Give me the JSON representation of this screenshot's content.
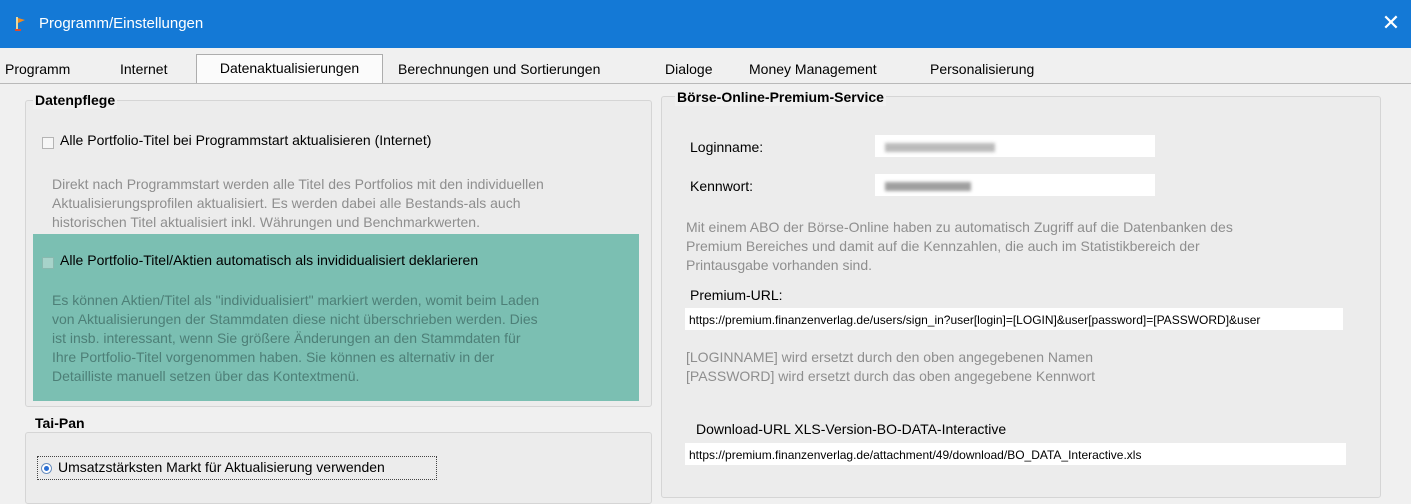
{
  "window": {
    "title": "Programm/Einstellungen",
    "close_glyph": "✕",
    "app_icon": "app-flag-icon"
  },
  "tabs": [
    {
      "label": "Programm"
    },
    {
      "label": "Internet"
    },
    {
      "label": "Datenaktualisierungen",
      "active": true
    },
    {
      "label": "Berechnungen und Sortierungen"
    },
    {
      "label": "Dialoge"
    },
    {
      "label": "Money Management"
    },
    {
      "label": "Personalisierung"
    }
  ],
  "datenpflege": {
    "title": "Datenpflege",
    "option1_label": "Alle Portfolio-Titel bei Programmstart aktualisieren (Internet)",
    "option1_checked": false,
    "option1_desc": [
      "Direkt nach Programmstart werden alle Titel des Portfolios mit den individuellen",
      "Aktualisierungsprofilen aktualisiert. Es werden dabei alle Bestands-als auch",
      "historischen Titel aktualisiert inkl. Währungen und Benchmarkwerten."
    ],
    "option2_label": "Alle Portfolio-Titel/Aktien automatisch als invididualisiert deklarieren",
    "option2_checked": false,
    "option2_desc": [
      "Es können Aktien/Titel als \"individualisiert\" markiert werden, womit beim Laden",
      "von Aktualisierungen der Stammdaten diese nicht überschrieben werden. Dies",
      "ist insb. interessant, wenn Sie größere Änderungen an den Stammdaten für",
      "Ihre Portfolio-Titel vorgenommen haben. Sie können es alternativ in der",
      "Detailliste manuell setzen über das Kontextmenü."
    ],
    "highlight_color": "#7bbfb2"
  },
  "taipan": {
    "title": "Tai-Pan",
    "radio_label": "Umsatzstärksten Markt für Aktualisierung verwenden",
    "radio_selected": true
  },
  "boerse": {
    "title": "Börse-Online-Premium-Service",
    "login_label": "Loginname:",
    "password_label": "Kennwort:",
    "info": [
      "Mit einem ABO der Börse-Online haben zu automatisch Zugriff auf die Datenbanken des",
      "Premium Bereiches und damit auf die Kennzahlen, die auch im Statistikbereich der",
      "Printausgabe vorhanden sind."
    ],
    "premium_url_label": "Premium-URL:",
    "premium_url_value": "https://premium.finanzenverlag.de/users/sign_in?user[login]=[LOGIN]&user[password]=[PASSWORD]&user",
    "replace_notes": [
      "[LOGINNAME] wird ersetzt durch den oben angegebenen Namen",
      "[PASSWORD] wird ersetzt durch das oben angegebene Kennwort"
    ],
    "download_label": "Download-URL XLS-Version-BO-DATA-Interactive",
    "download_value": "https://premium.finanzenverlag.de/attachment/49/download/BO_DATA_Interactive.xls"
  },
  "colors": {
    "titlebar": "#1479d6",
    "background": "#f0f0f0"
  }
}
